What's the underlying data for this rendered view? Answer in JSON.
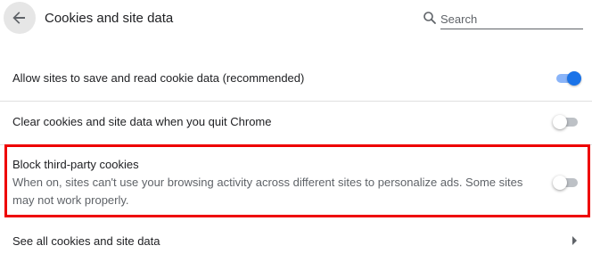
{
  "header": {
    "title": "Cookies and site data",
    "search_placeholder": "Search",
    "search_value": ""
  },
  "settings": [
    {
      "label": "Allow sites to save and read cookie data (recommended)",
      "enabled": true
    },
    {
      "label": "Clear cookies and site data when you quit Chrome",
      "enabled": false
    },
    {
      "label": "Block third-party cookies",
      "description": "When on, sites can't use your browsing activity across different sites to personalize ads. Some sites may not work properly.",
      "enabled": false,
      "highlighted": true
    },
    {
      "label": "See all cookies and site data"
    }
  ],
  "colors": {
    "accent": "#1a73e8",
    "highlight": "#ee0000"
  },
  "icons": [
    "back-arrow-icon",
    "search-icon",
    "chevron-right-icon"
  ]
}
